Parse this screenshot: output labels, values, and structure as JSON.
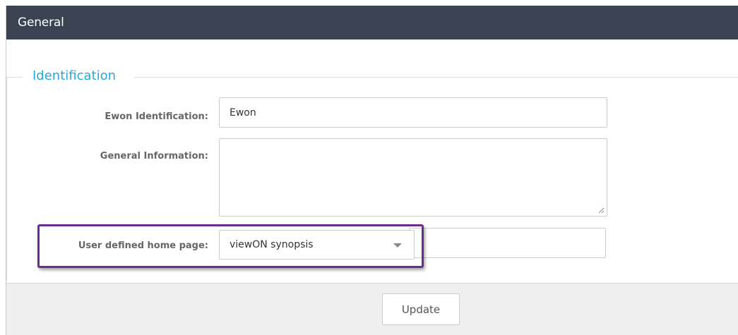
{
  "header": {
    "title": "General"
  },
  "fieldset": {
    "legend": "Identification"
  },
  "form": {
    "ewon_identification": {
      "label": "Ewon Identification:",
      "value": "Ewon"
    },
    "general_information": {
      "label": "General Information:",
      "value": ""
    },
    "user_defined_home_page": {
      "label": "User defined home page:",
      "selected": "viewON synopsis",
      "extra_value": ""
    }
  },
  "footer": {
    "update_label": "Update"
  },
  "colors": {
    "header_bg": "#3b4252",
    "legend": "#28a8d8",
    "highlight_border": "#6b2c8f"
  }
}
